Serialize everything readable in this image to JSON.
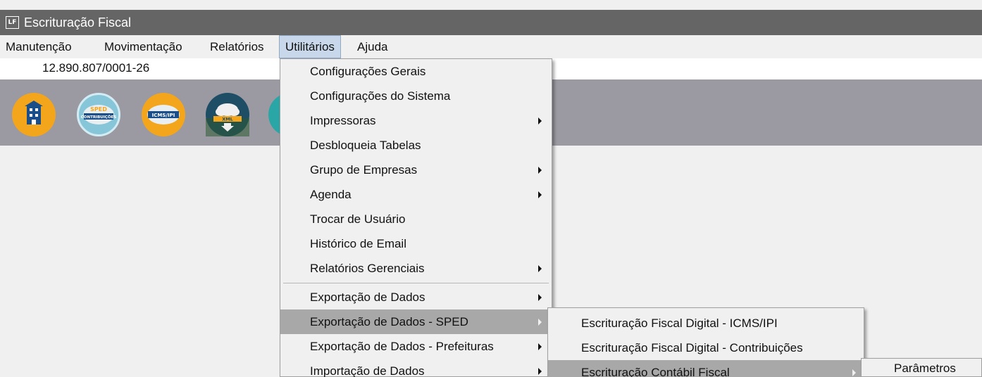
{
  "window": {
    "title": "Escrituração Fiscal",
    "badge": "LF"
  },
  "menubar": {
    "items": [
      "Manutenção",
      "Movimentação",
      "Relatórios",
      "Utilitários",
      "Ajuda"
    ]
  },
  "company": {
    "cnpj": "12.890.807/0001-26"
  },
  "toolbar": {
    "buttons": [
      {
        "icon": "building-icon"
      },
      {
        "icon": "sped-contribuicoes-icon",
        "line1": "SPED",
        "line2": "CONTRIBUIÇÕES"
      },
      {
        "icon": "icms-ipi-icon",
        "label": "ICMS/IPI"
      },
      {
        "icon": "xml-download-icon",
        "label": "XML"
      },
      {
        "icon": "partial-icon"
      }
    ]
  },
  "utilitarios_menu": {
    "items": [
      "Configurações Gerais",
      "Configurações do Sistema",
      "Impressoras",
      "Desbloqueia Tabelas",
      "Grupo de Empresas",
      "Agenda",
      "Trocar de Usuário",
      "Histórico de Email",
      "Relatórios Gerenciais",
      "Exportação de Dados",
      "Exportação de Dados - SPED",
      "Exportação de Dados - Prefeituras",
      "Importação de Dados"
    ]
  },
  "sped_submenu": {
    "items": [
      "Escrituração Fiscal Digital - ICMS/IPI",
      "Escrituração Fiscal Digital - Contribuições",
      "Escrituração Contábil Fiscal"
    ]
  },
  "ecf_submenu": {
    "items": [
      "Parâmetros"
    ]
  },
  "colors": {
    "titlebar": "#656565",
    "toolbar": "#9b9aa2",
    "menu_bg": "#f0f0f0",
    "highlight": "#a8a8a8",
    "active_menu": "#c8d8ea"
  }
}
